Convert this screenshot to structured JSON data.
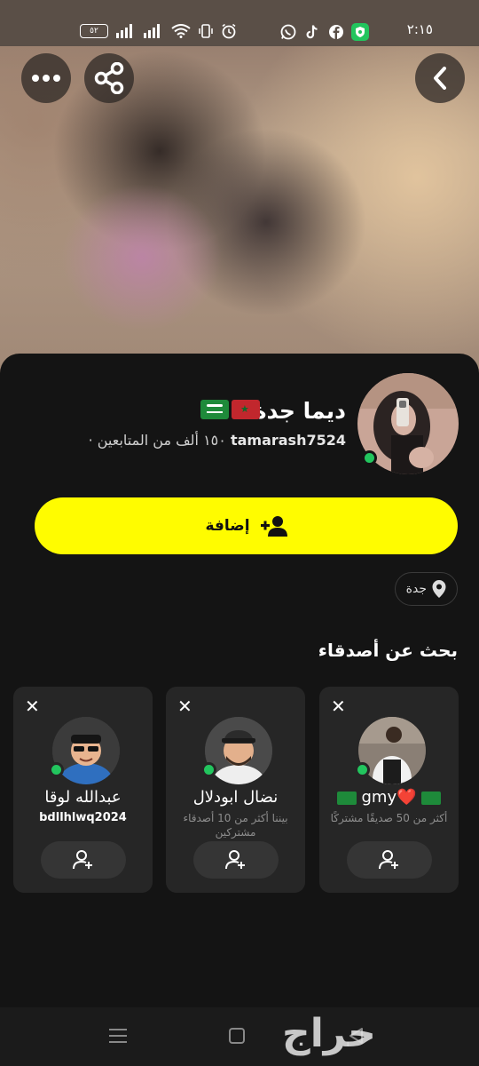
{
  "status_bar": {
    "time": "٢:١٥",
    "battery": "٥٢"
  },
  "profile": {
    "display_name": "ديما جدة",
    "username": "tamarash7524",
    "followers_text": "· ١٥٠ ألف من المتابعين",
    "add_button_label": "إضافة",
    "location": "جدة"
  },
  "suggestions": {
    "title": "بحث عن أصدقاء",
    "cards": [
      {
        "name": "gmy❤️",
        "subtitle": "أكثر من 50 صديقًا مشتركًا"
      },
      {
        "name": "نضال ابودلال",
        "subtitle": "بيننا أكثر من 10 أصدقاء مشتركين"
      },
      {
        "name": "عبدالله لوقا",
        "subtitle": "bdllhlwq2024"
      }
    ]
  },
  "watermark": "حراج",
  "icons": {
    "back": "chevron-left-icon",
    "share": "share-icon",
    "more": "more-icon",
    "add_friend": "add-friend-icon",
    "location": "location-pin-icon",
    "close": "close-icon"
  },
  "colors": {
    "accent": "#fffc00",
    "online": "#22c55e",
    "sheet_bg": "#141414",
    "card_bg": "#262626"
  }
}
